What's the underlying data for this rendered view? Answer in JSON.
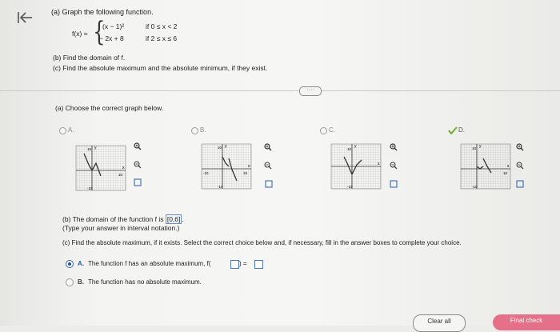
{
  "problem": {
    "title": "(a) Graph the following function.",
    "f_label": "f(x) =",
    "piece1_expr": "(x − 1)²",
    "piece1_cond": "if 0 ≤ x < 2",
    "piece2_expr": "− 2x + 8",
    "piece2_cond": "if 2 ≤ x ≤ 6",
    "part_b": "(b) Find the domain of f.",
    "part_c": "(c) Find the absolute maximum and the absolute minimum, if they exist."
  },
  "more_button": "····",
  "part_a": {
    "question": "(a) Choose the correct graph below.",
    "options": [
      {
        "label": "A.",
        "selected": false
      },
      {
        "label": "B.",
        "selected": false
      },
      {
        "label": "C.",
        "selected": false
      },
      {
        "label": "D.",
        "selected": true
      }
    ],
    "graph_labels": {
      "x": "x",
      "y": "y",
      "min": "-10",
      "max": "10"
    }
  },
  "part_b": {
    "answer_prefix": "(b) The domain of the function f is",
    "answer_value": "[0,6]",
    "answer_suffix": ".",
    "hint": "(Type your answer in interval notation.)"
  },
  "part_c": {
    "instruction": "(c) Find the absolute maximum, if it exists. Select the correct choice below and, if necessary, fill in the answer boxes to complete your choice.",
    "option_a_letter": "A.",
    "option_a_text": "The function f has an absolute maximum, f(",
    "option_a_mid": ") =",
    "option_b_letter": "B.",
    "option_b_text": "The function has no absolute maximum.",
    "selected": "A"
  },
  "buttons": {
    "clear_all": "Clear all",
    "final_check": "Final check"
  },
  "colors": {
    "accent_blue": "#1f4fa8",
    "final_check": "#e4708a",
    "checkmark": "#6fae2e"
  }
}
